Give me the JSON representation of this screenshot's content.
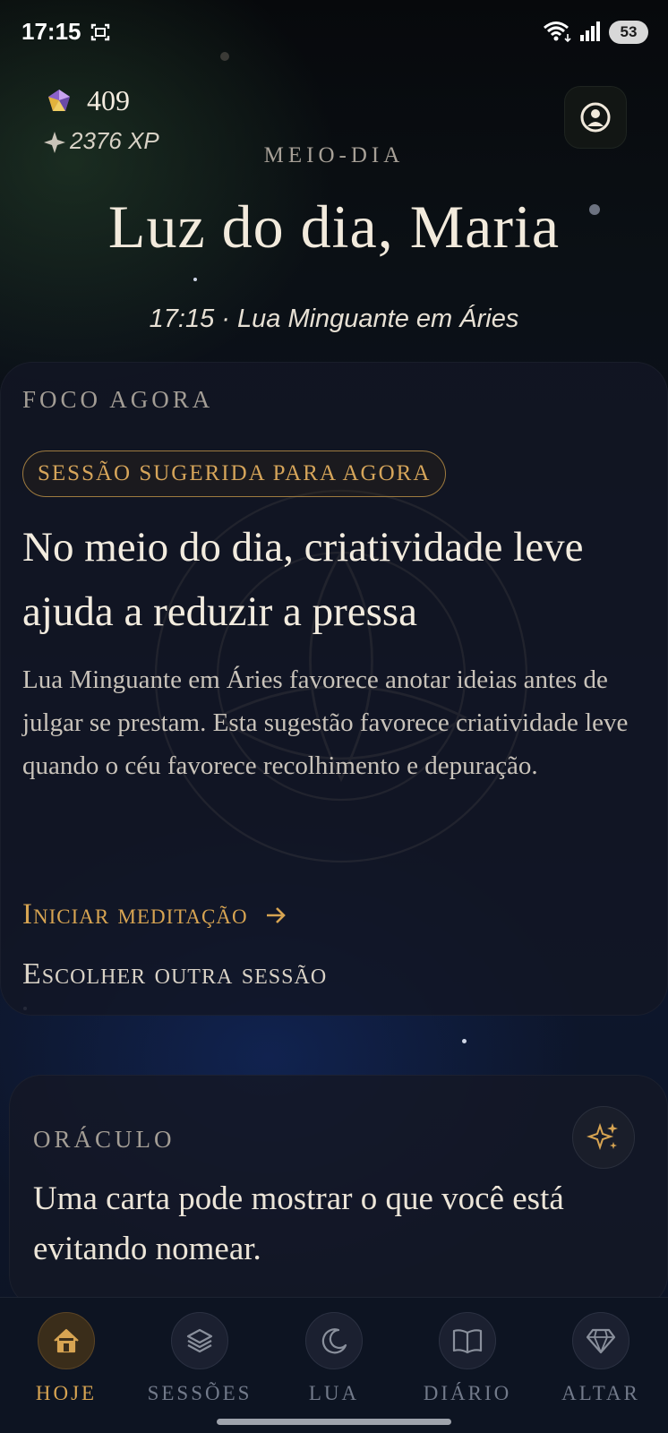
{
  "status_bar": {
    "time": "17:15",
    "battery": "53"
  },
  "header": {
    "gems": "409",
    "xp": "2376 XP",
    "period": "MEIO-DIA",
    "greeting": "Luz do dia, Maria",
    "subtitle": "17:15 · Lua Minguante em Áries"
  },
  "focus": {
    "label": "FOCO AGORA",
    "badge": "SESSÃO SUGERIDA PARA AGORA",
    "title": "No meio do dia, criatividade leve ajuda a reduzir a pressa",
    "body": "Lua Minguante em Áries favorece anotar ideias antes de julgar se prestam. Esta sugestão favorece criatividade leve quando o céu favorece recolhimento e depuração.",
    "start_label": "Iniciar meditação",
    "other_label": "Escolher outra sessão"
  },
  "oracle": {
    "label": "ORÁCULO",
    "text": "Uma carta pode mostrar o que você está evitando nomear."
  },
  "nav": {
    "items": [
      {
        "label": "HOJE",
        "icon": "home-icon"
      },
      {
        "label": "SESSÕES",
        "icon": "layers-icon"
      },
      {
        "label": "LUA",
        "icon": "moon-icon"
      },
      {
        "label": "DIÁRIO",
        "icon": "book-icon"
      },
      {
        "label": "ALTAR",
        "icon": "diamond-icon"
      }
    ]
  },
  "colors": {
    "accent": "#d7a452",
    "background": "#0c1220",
    "card": "#121624"
  }
}
